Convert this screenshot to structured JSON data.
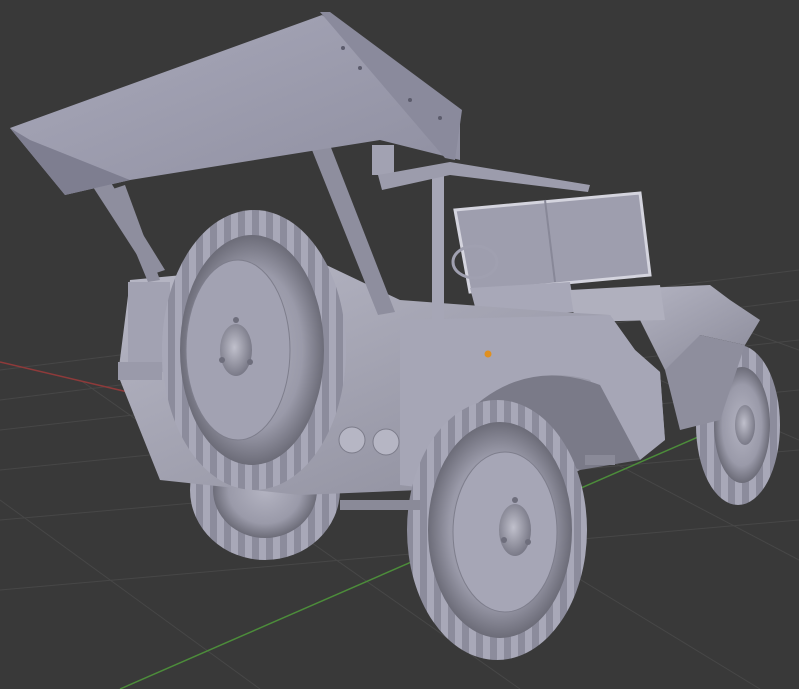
{
  "viewport": {
    "background": "#393939",
    "grid_color": "#454545",
    "x_axis_color": "#9a3b3b",
    "y_axis_color": "#4d8a3a",
    "origin_dot_color": "#e09020"
  },
  "model": {
    "name": "jeep",
    "shade_light": "#c8c8d4",
    "shade_mid": "#9c9cab",
    "shade_dark": "#5c5c68"
  }
}
